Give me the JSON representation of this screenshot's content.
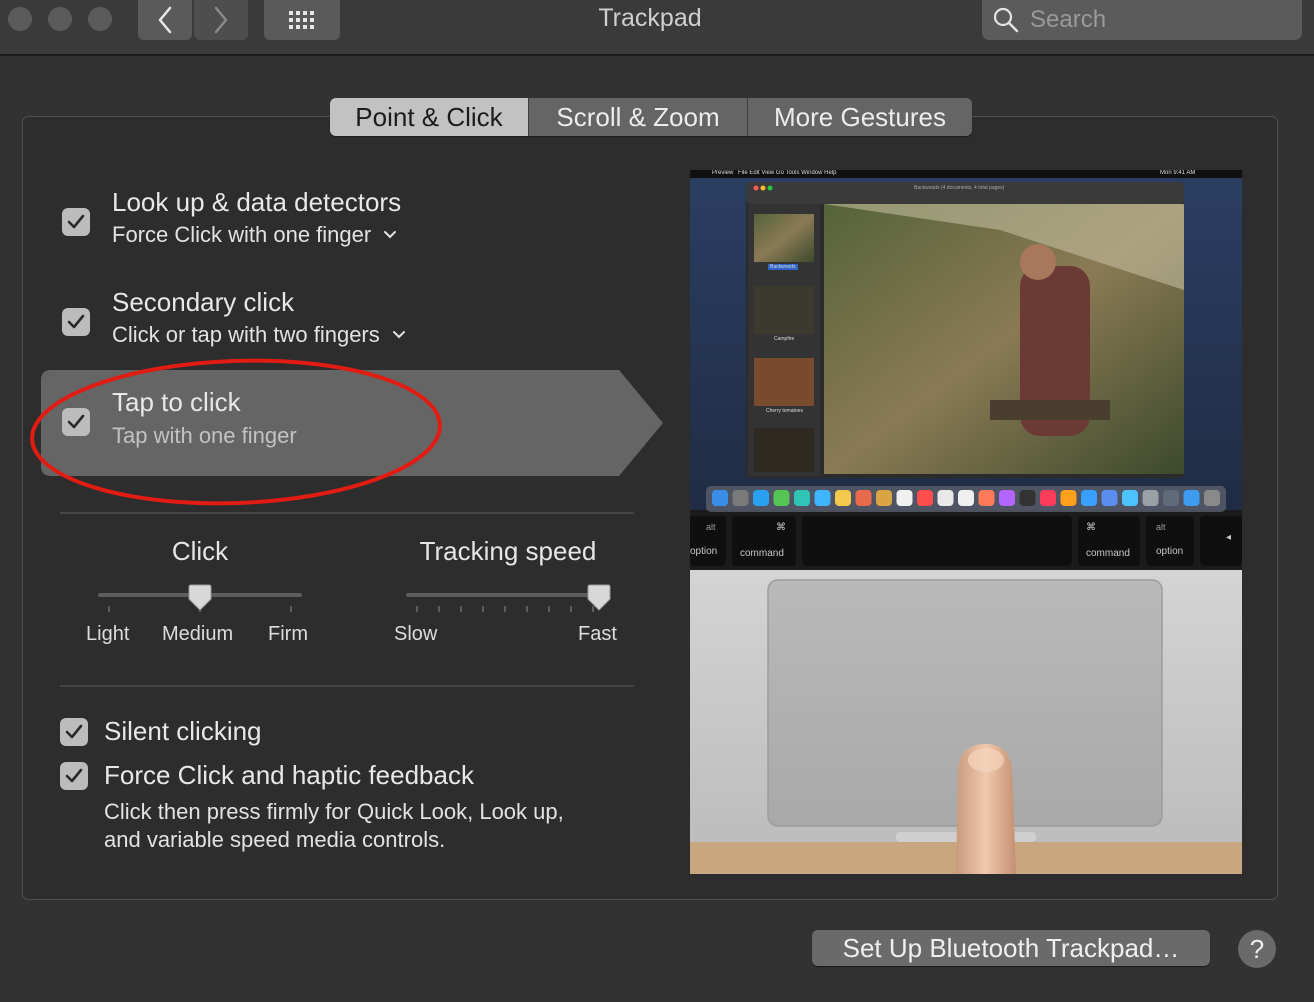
{
  "window": {
    "title": "Trackpad",
    "search_placeholder": "Search"
  },
  "tabs": [
    {
      "label": "Point & Click",
      "active": true
    },
    {
      "label": "Scroll & Zoom",
      "active": false
    },
    {
      "label": "More Gestures",
      "active": false
    }
  ],
  "options": [
    {
      "title": "Look up & data detectors",
      "subtitle": "Force Click with one finger",
      "checked": true,
      "has_dropdown": true
    },
    {
      "title": "Secondary click",
      "subtitle": "Click or tap with two fingers",
      "checked": true,
      "has_dropdown": true
    },
    {
      "title": "Tap to click",
      "subtitle": "Tap with one finger",
      "checked": true,
      "has_dropdown": false,
      "selected": true
    }
  ],
  "sliders": {
    "click": {
      "title": "Click",
      "labels": [
        "Light",
        "Medium",
        "Firm"
      ],
      "value": 0.5
    },
    "tracking": {
      "title": "Tracking speed",
      "min_label": "Slow",
      "max_label": "Fast",
      "value": 1.0
    }
  },
  "bottom_options": {
    "silent_clicking": {
      "label": "Silent clicking",
      "checked": true
    },
    "force_click": {
      "label": "Force Click and haptic feedback",
      "checked": true,
      "desc_line1": "Click then press firmly for Quick Look, Look up,",
      "desc_line2": "and variable speed media controls."
    }
  },
  "preview": {
    "menubar_app": "Preview",
    "menubar_items": [
      "File",
      "Edit",
      "View",
      "Go",
      "Tools",
      "Window",
      "Help"
    ],
    "clock": "Mon 9:41 AM",
    "doc_title": "Backwoods (4 documents, 4 total pages)",
    "thumbnails": [
      "Backwoods",
      "Campfire",
      "Cherry tomatoes",
      ""
    ],
    "keys": [
      "alt",
      "option",
      "command",
      "command",
      "alt",
      "option"
    ]
  },
  "buttons": {
    "bluetooth": "Set Up Bluetooth Trackpad…",
    "help": "?"
  },
  "colors": {
    "annotation": "#e11c12",
    "background": "#323232",
    "active_tab": "#c2c2c2"
  }
}
